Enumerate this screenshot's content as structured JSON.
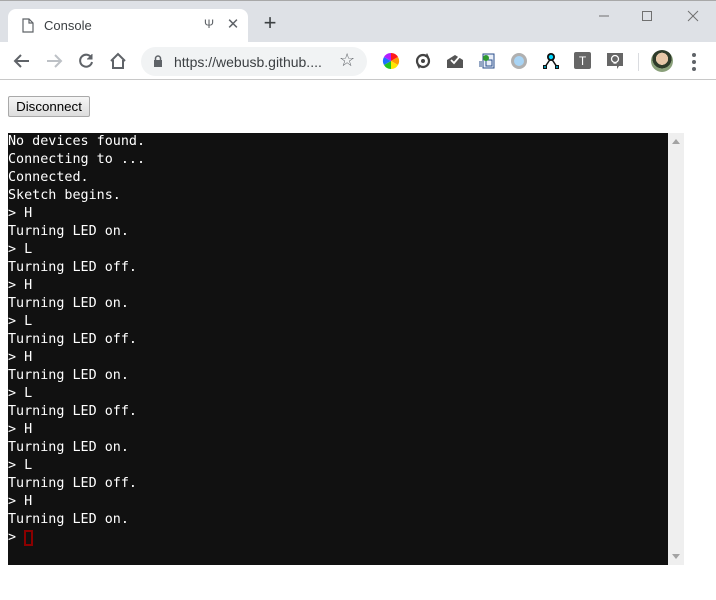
{
  "browser": {
    "tab": {
      "title": "Console",
      "page_icon": "page-icon",
      "usb_indicator": "Ψ",
      "close_glyph": "✕"
    },
    "new_tab_glyph": "+",
    "window_controls": {
      "minimize": "—",
      "maximize": "☐",
      "close": "✕"
    },
    "nav": {
      "back": "←",
      "forward": "→",
      "reload": "↻",
      "home": "⌂"
    },
    "omnibox": {
      "url": "https://webusb.github....",
      "star": "☆"
    },
    "extensions": [
      {
        "name": "color-wheel-extension-icon"
      },
      {
        "name": "sync-extension-icon"
      },
      {
        "name": "mail-extension-icon"
      },
      {
        "name": "document-extension-icon"
      },
      {
        "name": "circle-extension-icon"
      },
      {
        "name": "network-extension-icon"
      },
      {
        "name": "text-extension-icon",
        "label": "T"
      },
      {
        "name": "lightbulb-extension-icon"
      }
    ]
  },
  "page": {
    "disconnect_label": "Disconnect",
    "console": {
      "lines": [
        "No devices found.",
        "Connecting to ...",
        "Connected.",
        "Sketch begins.",
        "> H",
        "Turning LED on.",
        "> L",
        "Turning LED off.",
        "> H",
        "Turning LED on.",
        "> L",
        "Turning LED off.",
        "> H",
        "Turning LED on.",
        "> L",
        "Turning LED off.",
        "> H",
        "Turning LED on.",
        "> L",
        "Turning LED off.",
        "> H",
        "Turning LED on."
      ],
      "prompt": "> ",
      "cursor_color": "#8b0000",
      "background": "#111111",
      "foreground": "#ffffff"
    }
  }
}
